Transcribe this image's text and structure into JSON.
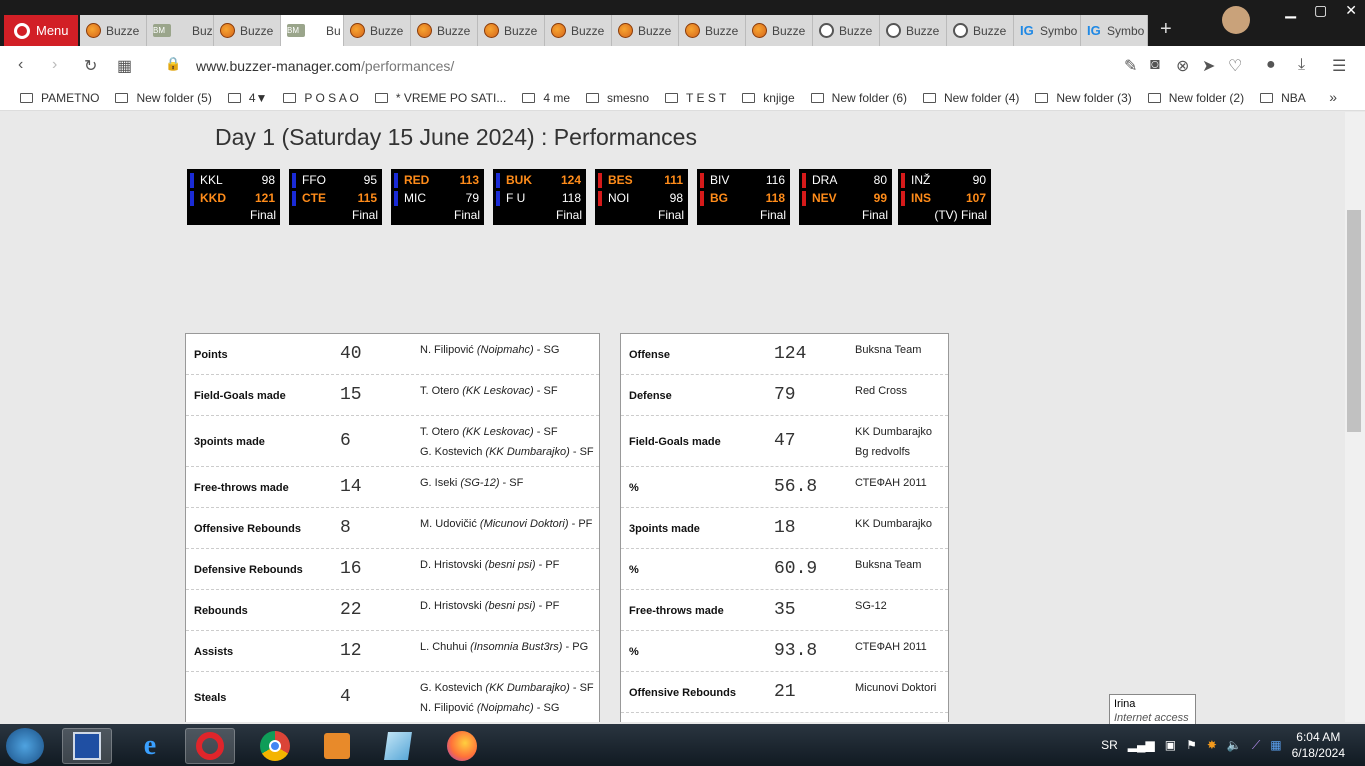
{
  "browser": {
    "menu_label": "Menu",
    "tabs": [
      {
        "label": "Buzze",
        "icon": "ball"
      },
      {
        "label": "Buzze",
        "icon": "bm"
      },
      {
        "label": "Buzze",
        "icon": "ball"
      },
      {
        "label": "Bu",
        "icon": "bm",
        "active": true
      },
      {
        "label": "Buzze",
        "icon": "ball"
      },
      {
        "label": "Buzze",
        "icon": "ball"
      },
      {
        "label": "Buzze",
        "icon": "ball"
      },
      {
        "label": "Buzze",
        "icon": "ball"
      },
      {
        "label": "Buzze",
        "icon": "ball"
      },
      {
        "label": "Buzze",
        "icon": "ball"
      },
      {
        "label": "Buzze",
        "icon": "ball"
      },
      {
        "label": "Buzze",
        "icon": "globe"
      },
      {
        "label": "Buzze",
        "icon": "globe"
      },
      {
        "label": "Buzze",
        "icon": "globe"
      },
      {
        "label": "Symbo",
        "icon": "sym"
      },
      {
        "label": "Symbo",
        "icon": "sym"
      }
    ],
    "url_host": "www.buzzer-manager.com",
    "url_path": "/performances/",
    "bookmarks": [
      "PAMETNO",
      "New folder (5)",
      "4▼",
      "P O S A O",
      "*   VREME PO SATI...",
      "4 me",
      "smesno",
      "T E S T",
      "knjige",
      "New folder (6)",
      "New folder (4)",
      "New folder (3)",
      "New folder (2)",
      "NBA"
    ]
  },
  "page": {
    "title": "Day 1 (Saturday 15 June 2024) : Performances",
    "games": [
      {
        "home": "KKL",
        "home_score": "98",
        "away": "KKD",
        "away_score": "121",
        "winner": "away",
        "home_color": "#1a2bd6",
        "away_color": "#1a2bd6",
        "status": "Final"
      },
      {
        "home": "FFO",
        "home_score": "95",
        "away": "CTE",
        "away_score": "115",
        "winner": "away",
        "home_color": "#1a2bd6",
        "away_color": "#1a2bd6",
        "status": "Final"
      },
      {
        "home": "RED",
        "home_score": "113",
        "away": "MIC",
        "away_score": "79",
        "winner": "home",
        "home_color": "#1a2bd6",
        "away_color": "#1a2bd6",
        "status": "Final"
      },
      {
        "home": "BUK",
        "home_score": "124",
        "away": "F U",
        "away_score": "118",
        "winner": "home",
        "home_color": "#1a2bd6",
        "away_color": "#1a2bd6",
        "status": "Final"
      },
      {
        "home": "BES",
        "home_score": "111",
        "away": "NOI",
        "away_score": "98",
        "winner": "home",
        "home_color": "#d61a1a",
        "away_color": "#d61a1a",
        "status": "Final"
      },
      {
        "home": "BIV",
        "home_score": "116",
        "away": "BG",
        "away_score": "118",
        "winner": "away",
        "home_color": "#d61a1a",
        "away_color": "#d61a1a",
        "status": "Final"
      },
      {
        "home": "DRA",
        "home_score": "80",
        "away": "NEV",
        "away_score": "99",
        "winner": "away",
        "home_color": "#d61a1a",
        "away_color": "#d61a1a",
        "status": "Final"
      },
      {
        "home": "INŽ",
        "home_score": "90",
        "away": "INS",
        "away_score": "107",
        "winner": "away",
        "home_color": "#d61a1a",
        "away_color": "#d61a1a",
        "status": "(TV) Final"
      }
    ],
    "player_stats": [
      {
        "label": "Points",
        "value": "40",
        "players": [
          {
            "name": "N. Filipović",
            "team": "(Noipmahc)",
            "pos": "- SG"
          }
        ]
      },
      {
        "label": "Field-Goals made",
        "value": "15",
        "players": [
          {
            "name": "T. Otero",
            "team": "(KK Leskovac)",
            "pos": "- SF"
          }
        ]
      },
      {
        "label": "3points made",
        "value": "6",
        "players": [
          {
            "name": "T. Otero",
            "team": "(KK Leskovac)",
            "pos": "- SF"
          },
          {
            "name": "G. Kostevich",
            "team": "(KK Dumbarajko)",
            "pos": "- SF"
          }
        ]
      },
      {
        "label": "Free-throws made",
        "value": "14",
        "players": [
          {
            "name": "G. Iseki",
            "team": "(SG-12)",
            "pos": "- SF"
          }
        ]
      },
      {
        "label": "Offensive Rebounds",
        "value": "8",
        "players": [
          {
            "name": "M. Udovičić",
            "team": "(Micunovi Doktori)",
            "pos": "- PF"
          }
        ]
      },
      {
        "label": "Defensive Rebounds",
        "value": "16",
        "players": [
          {
            "name": "D. Hristovski",
            "team": "(besni psi)",
            "pos": "- PF"
          }
        ]
      },
      {
        "label": "Rebounds",
        "value": "22",
        "players": [
          {
            "name": "D. Hristovski",
            "team": "(besni psi)",
            "pos": "- PF"
          }
        ]
      },
      {
        "label": "Assists",
        "value": "12",
        "players": [
          {
            "name": "L. Chuhui",
            "team": "(Insomnia Bust3rs)",
            "pos": "- PG"
          }
        ]
      },
      {
        "label": "Steals",
        "value": "4",
        "players": [
          {
            "name": "G. Kostevich",
            "team": "(KK Dumbarajko)",
            "pos": "- SF"
          },
          {
            "name": "N. Filipović",
            "team": "(Noipmahc)",
            "pos": "- SG"
          }
        ]
      }
    ],
    "team_stats": [
      {
        "label": "Offense",
        "value": "124",
        "teams": [
          "Buksna Team"
        ]
      },
      {
        "label": "Defense",
        "value": "79",
        "teams": [
          "Red Cross"
        ]
      },
      {
        "label": "Field-Goals made",
        "value": "47",
        "teams": [
          "KK Dumbarajko",
          "Bg redvolfs"
        ]
      },
      {
        "label": "%",
        "value": "56.8",
        "teams": [
          "СТЕФАН 2011"
        ]
      },
      {
        "label": "3points made",
        "value": "18",
        "teams": [
          "KK Dumbarajko"
        ]
      },
      {
        "label": "%",
        "value": "60.9",
        "teams": [
          "Buksna Team"
        ]
      },
      {
        "label": "Free-throws made",
        "value": "35",
        "teams": [
          "SG-12"
        ]
      },
      {
        "label": "%",
        "value": "93.8",
        "teams": [
          "СТЕФАН 2011"
        ]
      },
      {
        "label": "Offensive Rebounds",
        "value": "21",
        "teams": [
          "Micunovi Doktori"
        ]
      }
    ]
  },
  "taskbar": {
    "lang": "SR",
    "time": "6:04 AM",
    "date": "6/18/2024",
    "tooltip_title": "Irina",
    "tooltip_sub": "Internet access"
  }
}
